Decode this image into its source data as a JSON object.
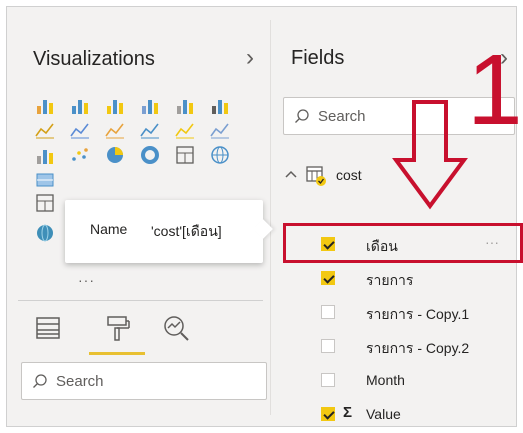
{
  "visualizations": {
    "title": "Visualizations",
    "expand_chevron": "›",
    "icons": [
      "stacked-bar-icon",
      "stacked-column-icon",
      "clustered-bar-icon",
      "clustered-column-icon",
      "100-bar-icon",
      "100-column-icon",
      "line-chart-icon",
      "area-chart-icon",
      "stacked-area-icon",
      "line-column-icon",
      "line-column-2-icon",
      "ribbon-icon",
      "waterfall-icon",
      "scatter-icon",
      "pie-icon",
      "donut-icon",
      "treemap-icon",
      "map-icon",
      "filled-map-icon",
      "table-icon",
      "globe-icon"
    ],
    "more_label": "···",
    "tools": [
      "fields-tool-icon",
      "format-tool-icon",
      "analytics-tool-icon"
    ],
    "search_placeholder": "Search"
  },
  "tooltip": {
    "label": "Name",
    "value": "'cost'[เดือน]"
  },
  "fields": {
    "title": "Fields",
    "expand_chevron": "›",
    "search_placeholder": "Search",
    "table": {
      "name": "cost",
      "expanded": true
    },
    "items": [
      {
        "name": "เดือน",
        "checked": true,
        "sigma": false,
        "highlighted": true
      },
      {
        "name": "รายการ",
        "checked": true,
        "sigma": false,
        "highlighted": false
      },
      {
        "name": "รายการ - Copy.1",
        "checked": false,
        "sigma": false,
        "highlighted": false
      },
      {
        "name": "รายการ - Copy.2",
        "checked": false,
        "sigma": false,
        "highlighted": false
      },
      {
        "name": "Month",
        "checked": false,
        "sigma": false,
        "highlighted": false
      },
      {
        "name": "Value",
        "checked": true,
        "sigma": true,
        "highlighted": false
      }
    ],
    "more_label": "···"
  },
  "annotation": {
    "step_number": "1",
    "color": "#c8102e"
  },
  "colors": {
    "accent_yellow": "#f2c811",
    "highlight_red": "#c8102e",
    "pane_bg": "#f3f2f1"
  }
}
